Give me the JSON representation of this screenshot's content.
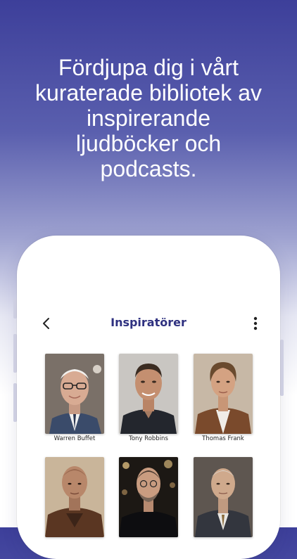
{
  "headline": "Fördjupa dig i vårt\nkuraterade bibliotek av\ninspirerande\nljudböcker och\npodcasts.",
  "screen": {
    "title": "Inspiratörer",
    "back_icon": "chevron-left-icon",
    "more_icon": "more-vertical-icon"
  },
  "inspirers": [
    {
      "name": "Warren Buffet"
    },
    {
      "name": "Tony Robbins"
    },
    {
      "name": "Thomas Frank"
    },
    {
      "name": ""
    },
    {
      "name": ""
    },
    {
      "name": ""
    }
  ],
  "colors": {
    "accent": "#2f3180",
    "gradient_top": "#3d3f9a"
  }
}
